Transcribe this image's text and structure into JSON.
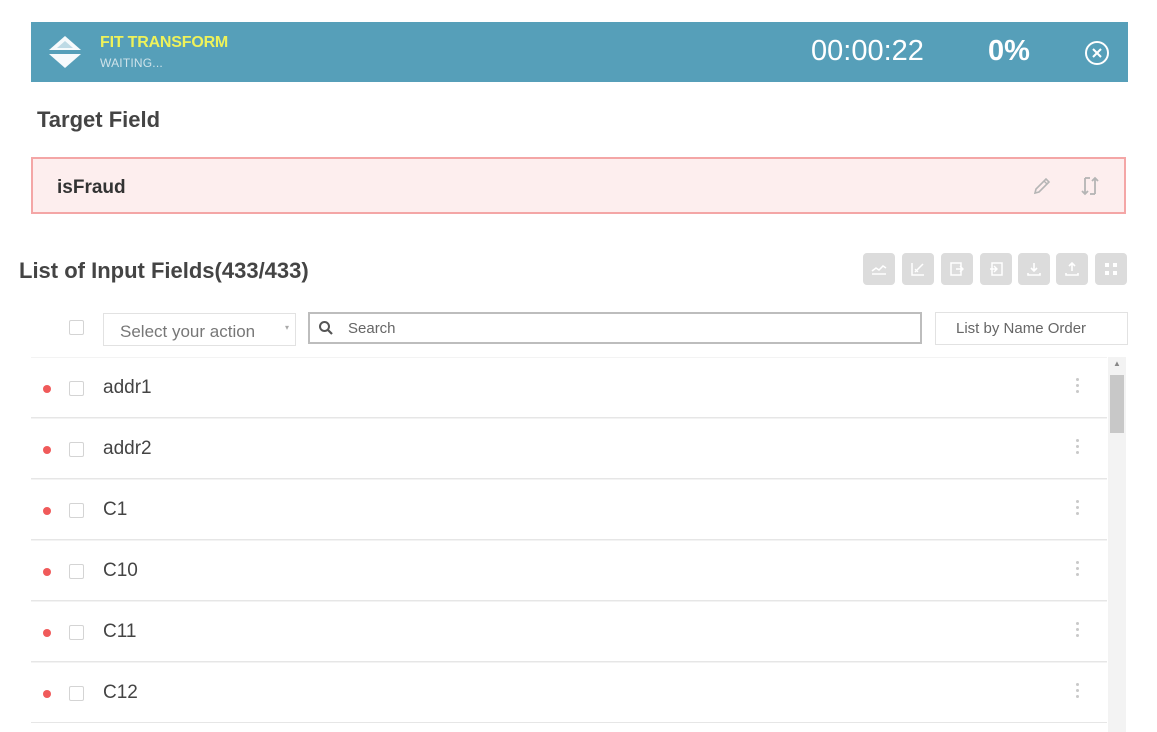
{
  "header": {
    "title": "FIT TRANSFORM",
    "status": "WAITING...",
    "timer": "00:00:22",
    "progress": "0%",
    "close_icon": "close-circle-icon"
  },
  "target": {
    "heading": "Target Field",
    "value": "isFraud"
  },
  "input_fields": {
    "heading": "List of Input Fields(433/433)",
    "toolbar_icons": [
      "chart-icon",
      "edit-chart-icon",
      "export-left-icon",
      "export-right-icon",
      "download-icon",
      "upload-icon",
      "grid-icon"
    ],
    "select_action_label": "Select your action",
    "search_placeholder": "Search",
    "order_label": "List by Name Order",
    "rows": [
      {
        "name": "addr1"
      },
      {
        "name": "addr2"
      },
      {
        "name": "C1"
      },
      {
        "name": "C10"
      },
      {
        "name": "C11"
      },
      {
        "name": "C12"
      }
    ]
  },
  "colors": {
    "header_bg": "#569fb9",
    "header_title": "#eef25a",
    "target_bg": "#fdeeee",
    "target_border": "#f4a6a6",
    "dot": "#f05a5a"
  }
}
